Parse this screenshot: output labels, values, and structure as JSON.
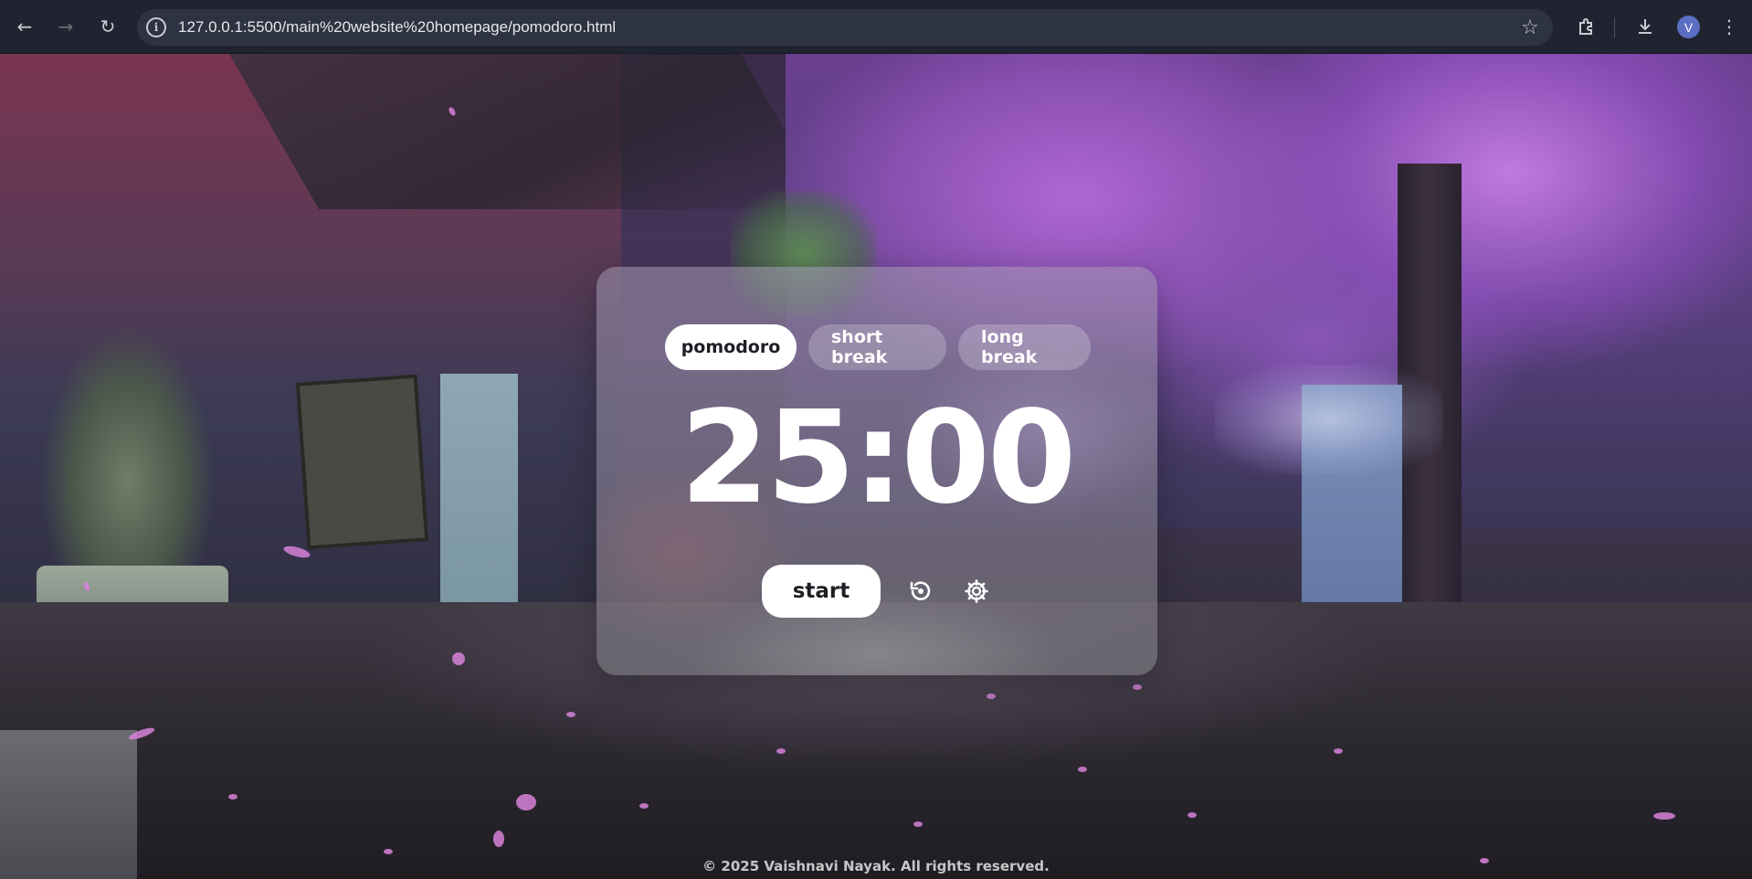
{
  "browser": {
    "url": "127.0.0.1:5500/main%20website%20homepage/pomodoro.html",
    "back_icon": "arrow-left-icon",
    "forward_icon": "arrow-right-icon",
    "reload_icon": "reload-icon",
    "site_info_icon": "info-icon",
    "bookmark_icon": "star-icon",
    "extensions_icon": "puzzle-icon",
    "downloads_icon": "download-icon",
    "menu_icon": "kebab-menu-icon",
    "profile_initial": "V"
  },
  "timer": {
    "modes": [
      {
        "label": "pomodoro",
        "active": true
      },
      {
        "label": "short break",
        "active": false
      },
      {
        "label": "long break",
        "active": false
      }
    ],
    "display": "25:00",
    "start_label": "start",
    "reset_icon": "reset-icon",
    "settings_icon": "gear-icon"
  },
  "footer": {
    "text": "© 2025 Vaishnavi Nayak. All rights reserved."
  },
  "colors": {
    "browser_bar": "#1f2430",
    "omnibox": "#2d3340",
    "active_tab_bg": "#ffffff",
    "avatar": "#5b6ec4"
  }
}
